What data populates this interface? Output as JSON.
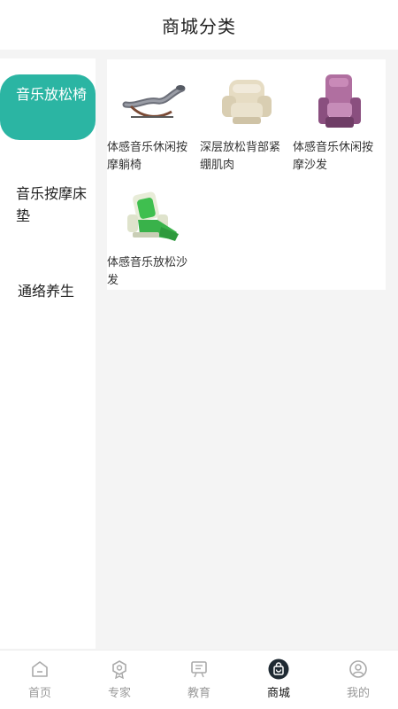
{
  "header": {
    "title": "商城分类"
  },
  "sidebar": {
    "items": [
      {
        "label": "音乐放松椅",
        "active": true
      },
      {
        "label": "音乐按摩床垫",
        "active": false
      },
      {
        "label": "通络养生",
        "active": false
      }
    ]
  },
  "products": [
    {
      "name": "体感音乐休闲按摩躺椅",
      "icon": "lounge-chair-image"
    },
    {
      "name": "深层放松背部紧绷肌肉",
      "icon": "recliner-image"
    },
    {
      "name": "体感音乐休闲按摩沙发",
      "icon": "massage-sofa-image"
    },
    {
      "name": "体感音乐放松沙发",
      "icon": "green-recliner-image"
    }
  ],
  "tabbar": {
    "items": [
      {
        "label": "首页",
        "icon": "home-icon"
      },
      {
        "label": "专家",
        "icon": "expert-badge-icon"
      },
      {
        "label": "教育",
        "icon": "education-board-icon"
      },
      {
        "label": "商城",
        "icon": "shopping-bag-icon",
        "active": true
      },
      {
        "label": "我的",
        "icon": "profile-icon"
      }
    ]
  },
  "colors": {
    "accent": "#2bb5a3",
    "active_tab": "#111111",
    "inactive_tab": "#999999"
  }
}
